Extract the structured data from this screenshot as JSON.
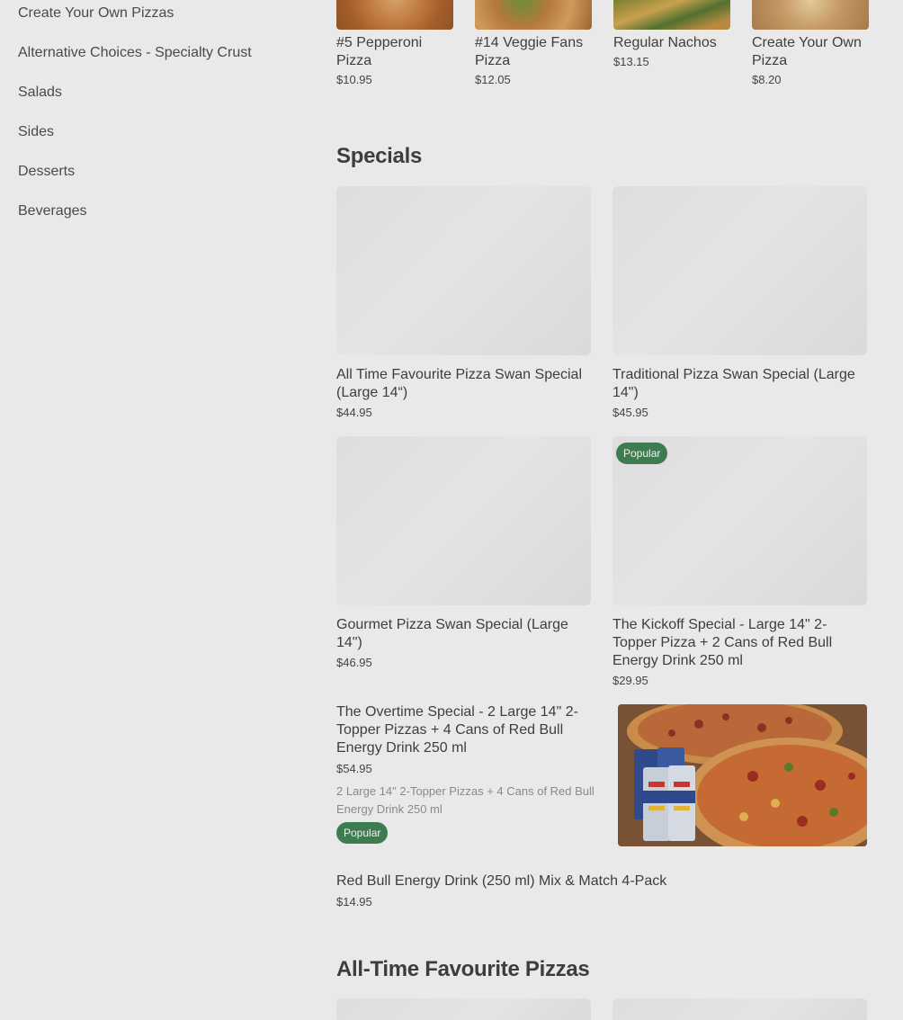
{
  "sidebar": {
    "items": [
      {
        "label": "Create Your Own Pizzas"
      },
      {
        "label": "Alternative Choices - Specialty Crust"
      },
      {
        "label": "Salads"
      },
      {
        "label": "Sides"
      },
      {
        "label": "Desserts"
      },
      {
        "label": "Beverages"
      }
    ]
  },
  "top_items": [
    {
      "title": "#5 Pepperoni Pizza",
      "price": "$10.95"
    },
    {
      "title": "#14 Veggie Fans Pizza",
      "price": "$12.05"
    },
    {
      "title": "Regular Nachos",
      "price": "$13.15"
    },
    {
      "title": "Create Your Own Pizza",
      "price": "$8.20"
    }
  ],
  "specials": {
    "heading": "Specials",
    "items": [
      {
        "title": "All Time Favourite Pizza Swan Special (Large 14“)",
        "price": "$44.95"
      },
      {
        "title": "Traditional Pizza Swan Special (Large 14\")",
        "price": "$45.95"
      },
      {
        "title": "Gourmet Pizza Swan Special (Large 14\")",
        "price": "$46.95"
      },
      {
        "title": "The Kickoff Special - Large 14\" 2-Topper Pizza + 2 Cans of Red Bull Energy Drink 250 ml",
        "price": "$29.95",
        "badge": "Popular"
      }
    ],
    "featured": {
      "title": "The Overtime Special - 2 Large 14\" 2-Topper Pizzas + 4 Cans of Red Bull Energy Drink 250 ml",
      "price": "$54.95",
      "description": "2 Large 14\" 2-Topper Pizzas + 4 Cans of Red Bull Energy Drink 250 ml",
      "badge": "Popular"
    },
    "plain": {
      "title": "Red Bull Energy Drink (250 ml) Mix & Match 4-Pack",
      "price": "$14.95"
    }
  },
  "all_time": {
    "heading": "All-Time Favourite Pizzas"
  },
  "colors": {
    "background": "#e9e9e9",
    "badge": "#3f7b50",
    "text": "#3e3e3e"
  }
}
